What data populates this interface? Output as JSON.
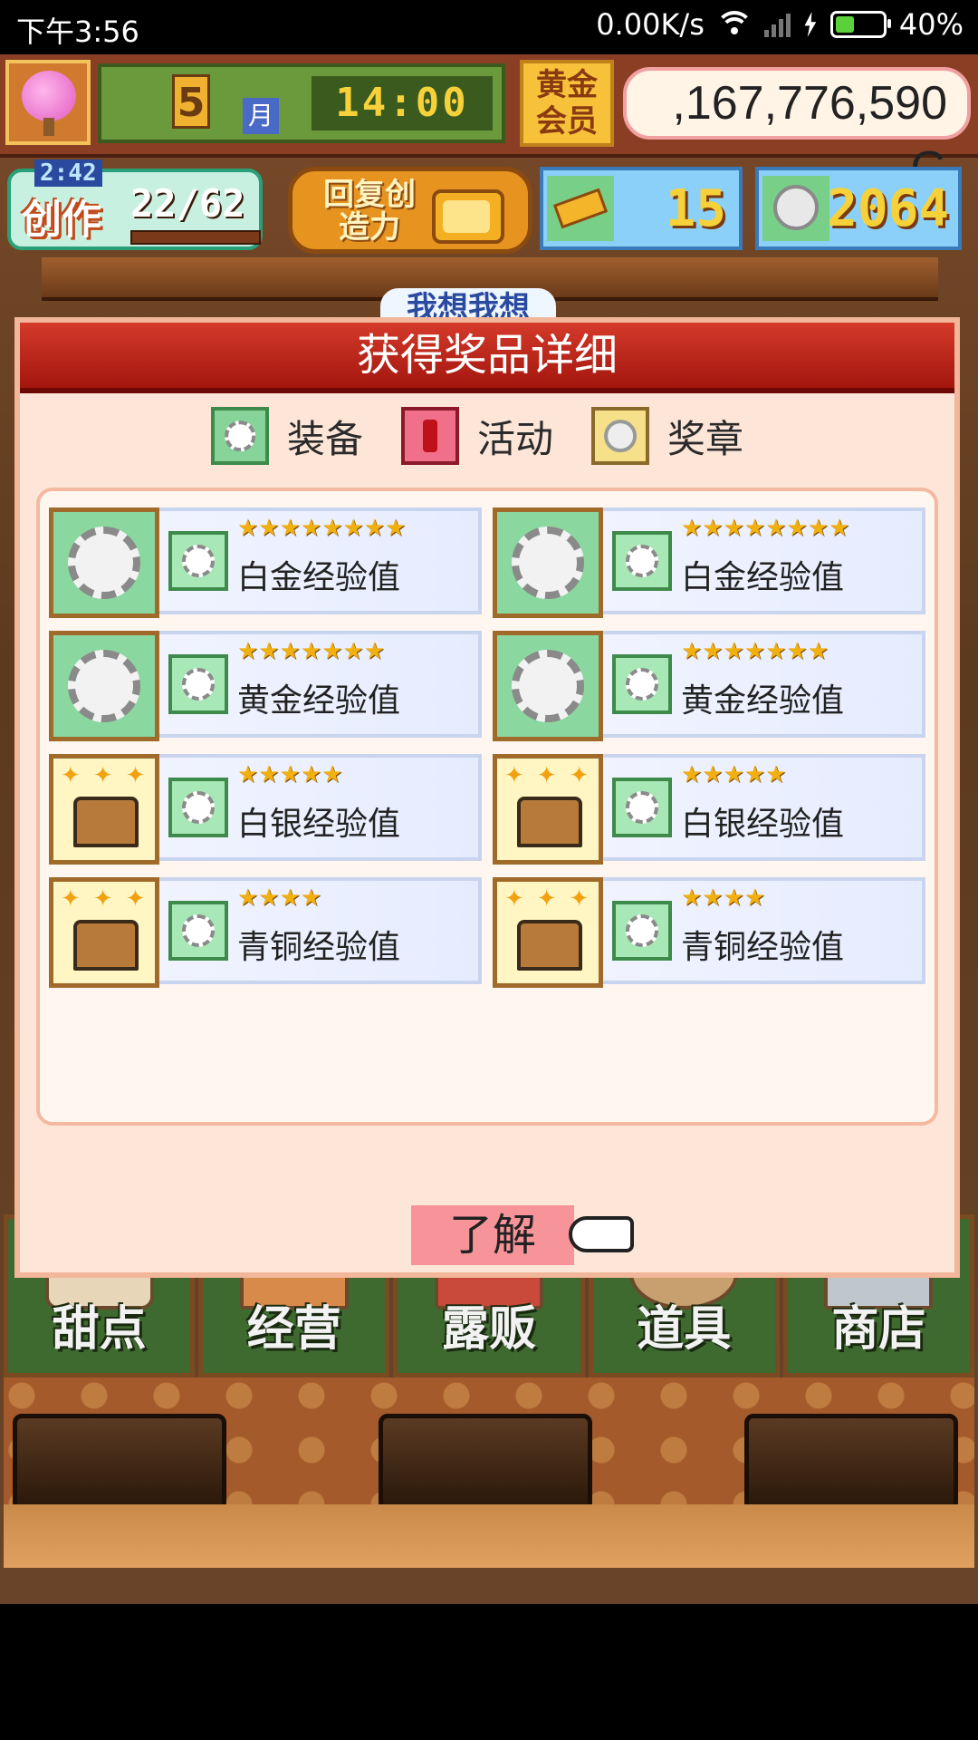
{
  "status_bar": {
    "time": "下午3:56",
    "net_speed": "0.00K/s",
    "battery_pct": "40%",
    "battery_level": 0.4
  },
  "hud": {
    "month": "5",
    "month_label": "月",
    "clock": "14:00",
    "gold_member": "黄金会员",
    "money": ",167,776,590 G",
    "create_timer": "2:42",
    "create_label": "创作",
    "create_count": "22/62",
    "restore_label": "回复创造力",
    "tickets": "15",
    "medals": "2064",
    "behind_label": "我想我想"
  },
  "dialog": {
    "title": "获得奖品详细",
    "legend": [
      {
        "icon": "gear-icon",
        "label": "装备"
      },
      {
        "icon": "exclamation-icon",
        "label": "活动"
      },
      {
        "icon": "medal-icon",
        "label": "奖章"
      }
    ],
    "items": [
      {
        "icon": "gear",
        "stars": "★★★★★★★★",
        "name": "白金经验值"
      },
      {
        "icon": "gear",
        "stars": "★★★★★★★★",
        "name": "白金经验值"
      },
      {
        "icon": "gear",
        "stars": "★★★★★★★",
        "name": "黄金经验值"
      },
      {
        "icon": "gear",
        "stars": "★★★★★★★",
        "name": "黄金经验值"
      },
      {
        "icon": "chest",
        "stars": "★★★★★",
        "name": "白银经验值"
      },
      {
        "icon": "chest",
        "stars": "★★★★★",
        "name": "白银经验值"
      },
      {
        "icon": "chest",
        "stars": "★★★★",
        "name": "青铜经验值"
      },
      {
        "icon": "chest",
        "stars": "★★★★",
        "name": "青铜经验值"
      }
    ],
    "ok_label": "了解"
  },
  "menu": [
    {
      "label": "甜点",
      "icon": "cake-icon"
    },
    {
      "label": "经营",
      "icon": "shop-icon"
    },
    {
      "label": "露贩",
      "icon": "food-truck-icon"
    },
    {
      "label": "道具",
      "icon": "item-bag-icon"
    },
    {
      "label": "商店",
      "icon": "cart-icon"
    }
  ]
}
